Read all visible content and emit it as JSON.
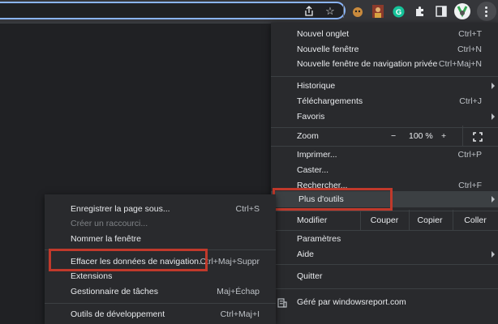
{
  "main_menu": {
    "new_tab": {
      "label": "Nouvel onglet",
      "shortcut": "Ctrl+T"
    },
    "new_window": {
      "label": "Nouvelle fenêtre",
      "shortcut": "Ctrl+N"
    },
    "new_incognito": {
      "label": "Nouvelle fenêtre de navigation privée",
      "shortcut": "Ctrl+Maj+N"
    },
    "history": {
      "label": "Historique"
    },
    "downloads": {
      "label": "Téléchargements",
      "shortcut": "Ctrl+J"
    },
    "bookmarks": {
      "label": "Favoris"
    },
    "zoom": {
      "label": "Zoom",
      "minus": "−",
      "value": "100 %",
      "plus": "+"
    },
    "print": {
      "label": "Imprimer...",
      "shortcut": "Ctrl+P"
    },
    "cast": {
      "label": "Caster..."
    },
    "find": {
      "label": "Rechercher...",
      "shortcut": "Ctrl+F"
    },
    "more_tools": {
      "label": "Plus d'outils"
    },
    "edit": {
      "label": "Modifier",
      "cut": "Couper",
      "copy": "Copier",
      "paste": "Coller"
    },
    "settings": {
      "label": "Paramètres"
    },
    "help": {
      "label": "Aide"
    },
    "exit": {
      "label": "Quitter"
    },
    "managed": {
      "label": "Géré par windowsreport.com"
    }
  },
  "sub_menu": {
    "save_page": {
      "label": "Enregistrer la page sous...",
      "shortcut": "Ctrl+S"
    },
    "create_shortcut": {
      "label": "Créer un raccourci..."
    },
    "name_window": {
      "label": "Nommer la fenêtre"
    },
    "clear_data": {
      "label": "Effacer les données de navigation...",
      "shortcut": "Ctrl+Maj+Suppr"
    },
    "extensions": {
      "label": "Extensions"
    },
    "task_manager": {
      "label": "Gestionnaire de tâches",
      "shortcut": "Maj+Échap"
    },
    "dev_tools": {
      "label": "Outils de développement",
      "shortcut": "Ctrl+Maj+I"
    }
  },
  "colors": {
    "highlight_box": "#c0392b",
    "background": "#202124",
    "menu_bg": "#292a2d"
  }
}
